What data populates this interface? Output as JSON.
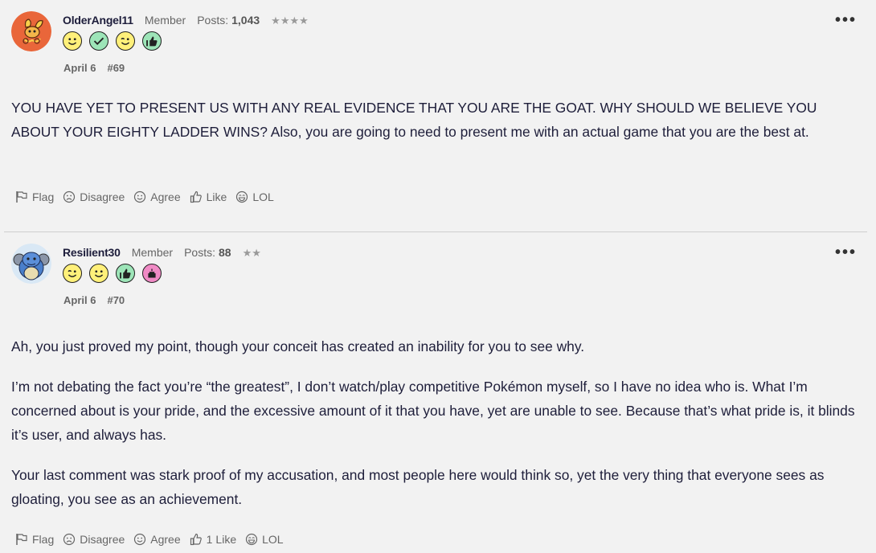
{
  "posts": [
    {
      "username": "OlderAngel11",
      "role": "Member",
      "posts_label": "Posts:",
      "posts_count": "1,043",
      "stars": "★★★★",
      "badges": [
        "smile-badge",
        "check-badge",
        "wink-badge",
        "thumbs-up-badge"
      ],
      "date": "April 6",
      "number": "#69",
      "body": [
        "YOU HAVE YET TO PRESENT US WITH ANY REAL EVIDENCE THAT YOU ARE THE GOAT. WHY SHOULD WE BELIEVE YOU ABOUT YOUR EIGHTY LADDER WINS? Also, you are going to need to present me with an actual game that you are the best at."
      ],
      "actions": {
        "flag": "Flag",
        "disagree": "Disagree",
        "agree": "Agree",
        "like": "Like",
        "like_count": "",
        "lol": "LOL"
      }
    },
    {
      "username": "Resilient30",
      "role": "Member",
      "posts_label": "Posts:",
      "posts_count": "88",
      "stars": "★★",
      "badges": [
        "wink-badge",
        "smile-badge",
        "thumbs-up-badge",
        "cake-badge"
      ],
      "date": "April 6",
      "number": "#70",
      "body": [
        "Ah, you just proved my point, though your conceit has created an inability for you to see why.",
        "I’m not debating the fact you’re “the greatest”, I don’t watch/play competitive Pokémon myself, so I have no idea who is. What I’m concerned about is your pride, and the excessive amount of it that you have, yet are unable to see. Because that’s what pride is, it blinds it’s user, and always has.",
        "Your last comment was stark proof of my accusation, and most people here would think so, yet the very thing that everyone sees as gloating, you see as an achievement."
      ],
      "actions": {
        "flag": "Flag",
        "disagree": "Disagree",
        "agree": "Agree",
        "like": "Like",
        "like_count": "1",
        "lol": "LOL"
      }
    }
  ],
  "more_glyph": "•••",
  "colors": {
    "background": "#f2f2f2",
    "username": "#1d1d3b",
    "body_text": "#1e1e3a",
    "meta_text": "#666666",
    "divider": "#cfcfcf",
    "badge_yellow": "#fff07a",
    "badge_green": "#9de5b8",
    "badge_pink": "#f08ac5"
  }
}
